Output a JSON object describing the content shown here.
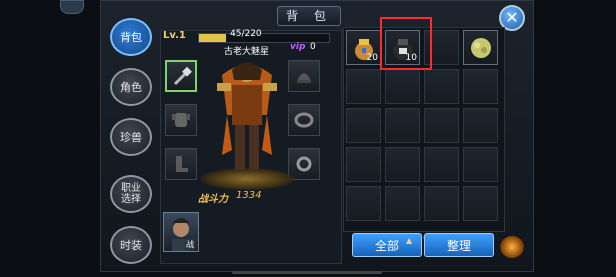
{
  "header": {
    "title": "背 包"
  },
  "tabs": [
    {
      "label": "背包",
      "active": true
    },
    {
      "label": "角色",
      "active": false
    },
    {
      "label": "珍兽",
      "active": false
    },
    {
      "label": "职业\n选择",
      "active": false
    },
    {
      "label": "时装",
      "active": false
    }
  ],
  "character": {
    "level_label": "Lv.1",
    "exp_text": "45/220",
    "exp_fraction": 0.2045,
    "name": "古老大魅星",
    "vip_label": "vip",
    "vip_level": "0",
    "power_label": "战斗力",
    "power_value": "1334",
    "portrait_tag": "战"
  },
  "inventory": {
    "items": [
      {
        "icon": "item-pouch-icon",
        "count": "20"
      },
      {
        "icon": "item-bag-icon",
        "count": "10"
      },
      {
        "icon": "empty",
        "count": ""
      },
      {
        "icon": "item-herb-icon",
        "count": ""
      }
    ],
    "rows": 5,
    "cols": 4
  },
  "buttons": {
    "all_label": "全部",
    "sort_label": "整理"
  },
  "colors": {
    "accent": "#2f7bd2",
    "highlight": "#ff2a2a",
    "gold": "#f0c050"
  }
}
